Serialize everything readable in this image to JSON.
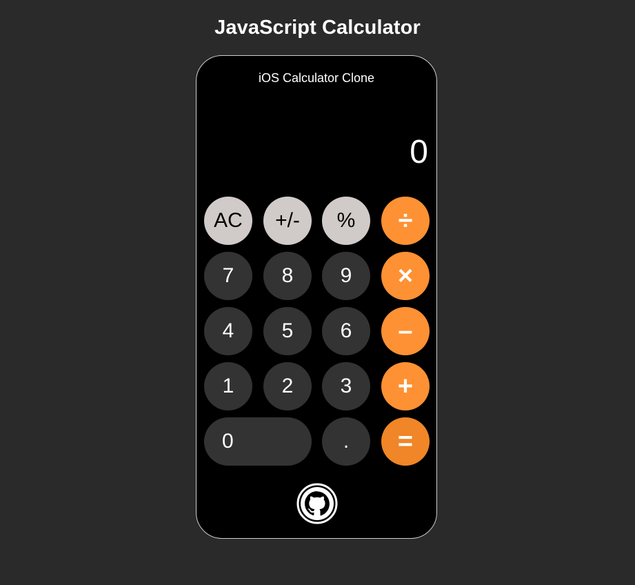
{
  "page": {
    "title": "JavaScript Calculator"
  },
  "calculator": {
    "subtitle": "iOS Calculator Clone",
    "display_value": "0",
    "keys": {
      "ac": "AC",
      "plus_minus": "+/-",
      "percent": "%",
      "divide": "÷",
      "seven": "7",
      "eight": "8",
      "nine": "9",
      "multiply": "×",
      "four": "4",
      "five": "5",
      "six": "6",
      "minus": "–",
      "one": "1",
      "two": "2",
      "three": "3",
      "plus": "+",
      "zero": "0",
      "decimal": ".",
      "equals": "="
    },
    "footer_icon": "github-icon"
  },
  "colors": {
    "page_background": "#2a2a2a",
    "calculator_background": "#000000",
    "function_key": "#d0cbc9",
    "number_key": "#333333",
    "operator_key": "#fe9133",
    "equals_key": "#f08627"
  }
}
